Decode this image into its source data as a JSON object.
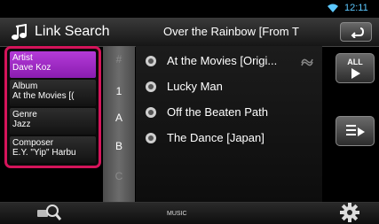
{
  "status": {
    "time": "12:11"
  },
  "header": {
    "title": "Link Search",
    "now_playing": "Over the Rainbow [From T"
  },
  "filters": [
    {
      "label": "Artist",
      "value": "Dave Koz",
      "selected": true
    },
    {
      "label": "Album",
      "value": "At the Movies [(",
      "selected": false
    },
    {
      "label": "Genre",
      "value": "Jazz",
      "selected": false
    },
    {
      "label": "Composer",
      "value": "E.Y. \"Yip\" Harbu",
      "selected": false
    }
  ],
  "index": [
    "#",
    "1",
    "A",
    "B",
    "C"
  ],
  "tracks": [
    {
      "title": "At the Movies [Origi..."
    },
    {
      "title": "Lucky Man"
    },
    {
      "title": "Off the Beaten Path"
    },
    {
      "title": "The Dance [Japan]"
    }
  ],
  "buttons": {
    "all_label": "ALL"
  },
  "bottom": {
    "source": "MUSIC"
  }
}
